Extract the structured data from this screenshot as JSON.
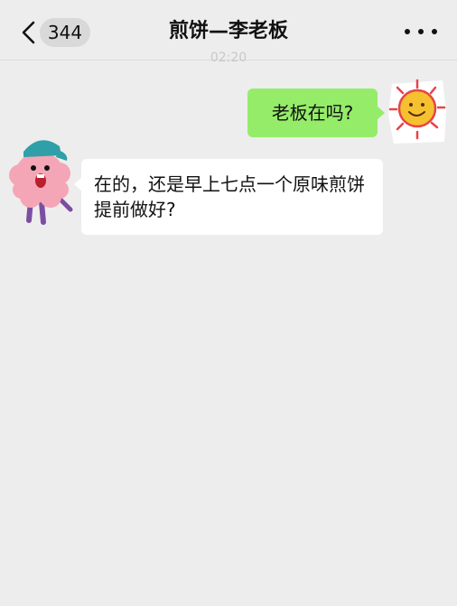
{
  "header": {
    "back_icon": "chevron-left-icon",
    "unread_count": "344",
    "title": "煎饼—李老板",
    "more_icon": "more-dots-icon"
  },
  "chat": {
    "timestamp": "02:20",
    "messages": [
      {
        "sender": "me",
        "text": "老板在吗?"
      },
      {
        "sender": "them",
        "text": "在的，还是早上七点一个原味煎饼提前做好?"
      }
    ]
  },
  "colors": {
    "background": "#ededed",
    "my_bubble": "#95ec69",
    "their_bubble": "#ffffff"
  }
}
